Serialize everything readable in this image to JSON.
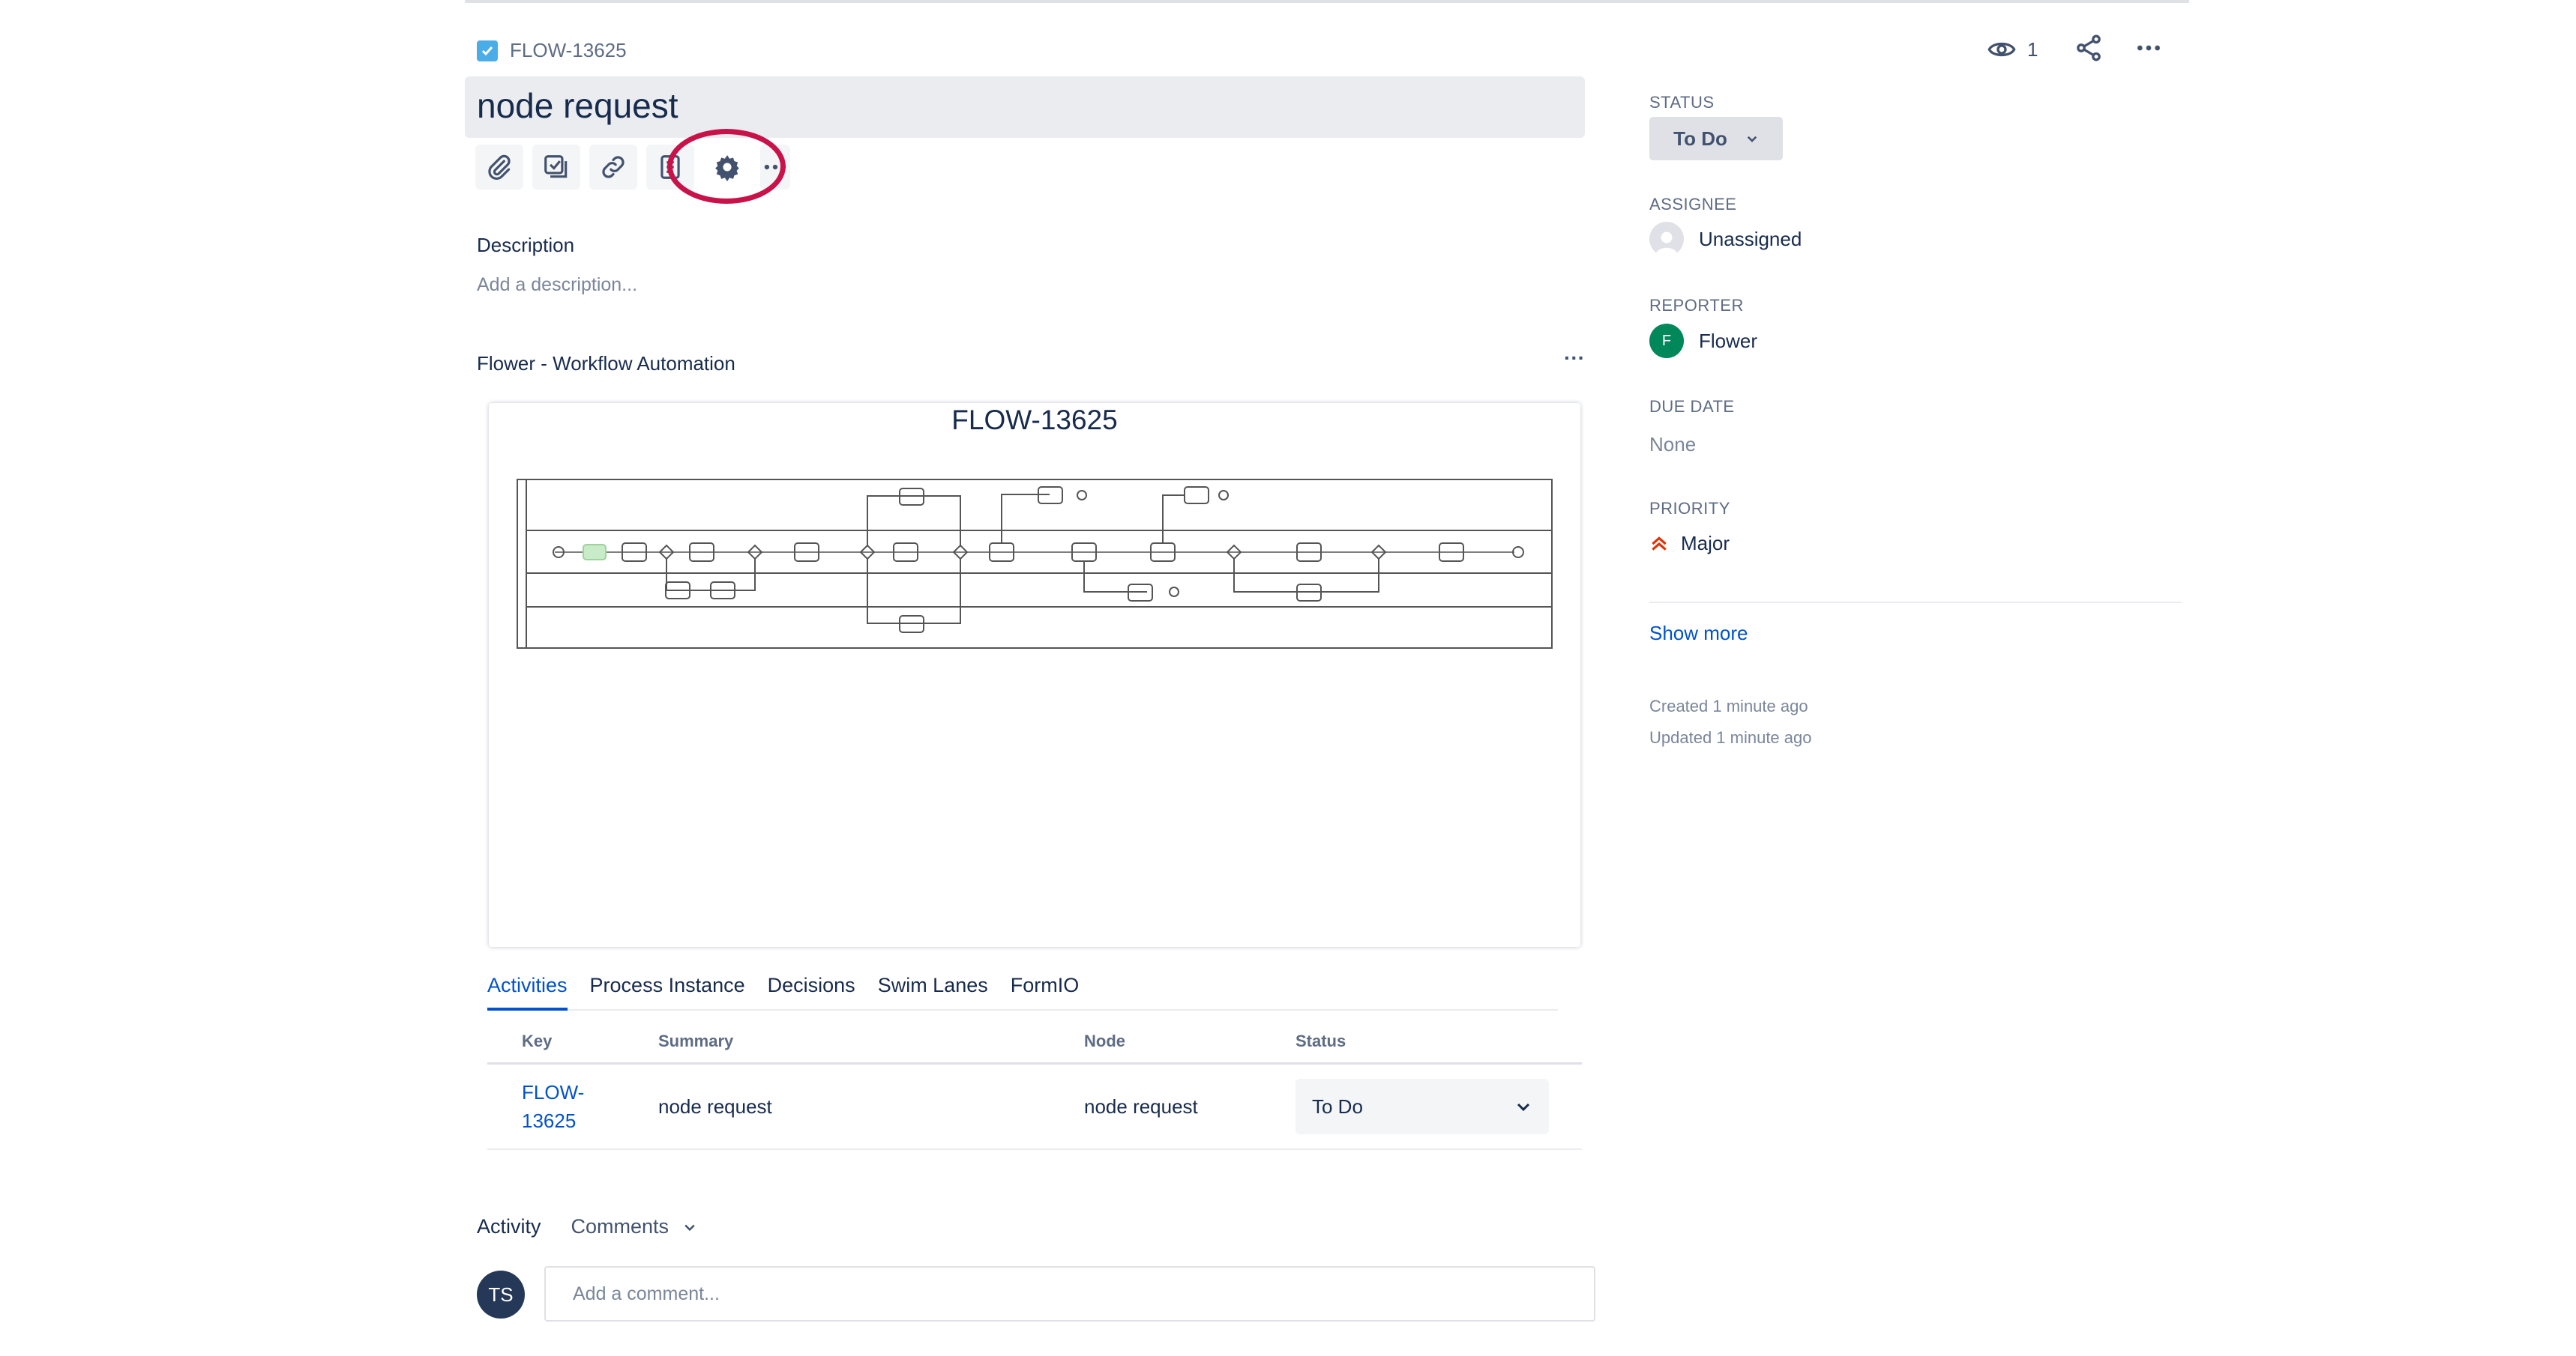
{
  "issue": {
    "key": "FLOW-13625",
    "title": "node request"
  },
  "toolbar": {
    "buttons": [
      "paperclip-icon",
      "subtask-icon",
      "link-icon",
      "page-icon",
      "gear-icon",
      "more-icon"
    ]
  },
  "description": {
    "heading": "Description",
    "placeholder": "Add a description..."
  },
  "workflow_panel": {
    "title": "Flower - Workflow Automation",
    "more": "···",
    "diagram_title": "FLOW-13625"
  },
  "tabs": [
    "Activities",
    "Process Instance",
    "Decisions",
    "Swim Lanes",
    "FormIO"
  ],
  "activities_table": {
    "headers": [
      "Key",
      "Summary",
      "Node",
      "Status"
    ],
    "rows": [
      {
        "key_line1": "FLOW-",
        "key_line2": "13625",
        "summary": "node request",
        "node": "node request",
        "status": "To Do"
      }
    ]
  },
  "activity": {
    "label": "Activity",
    "filter": "Comments",
    "avatar_initials": "TS",
    "comment_placeholder": "Add a comment..."
  },
  "header_actions": {
    "watchers": "1"
  },
  "sidebar": {
    "status_label": "STATUS",
    "status_value": "To Do",
    "assignee_label": "ASSIGNEE",
    "assignee_value": "Unassigned",
    "reporter_label": "REPORTER",
    "reporter_initial": "F",
    "reporter_value": "Flower",
    "due_label": "DUE DATE",
    "due_value": "None",
    "priority_label": "PRIORITY",
    "priority_value": "Major",
    "show_more": "Show more",
    "created": "Created 1 minute ago",
    "updated": "Updated 1 minute ago"
  },
  "colors": {
    "link": "#0052cc",
    "highlight": "#c8124a",
    "priority": "#de350b",
    "reporter_avatar": "#00875a"
  }
}
